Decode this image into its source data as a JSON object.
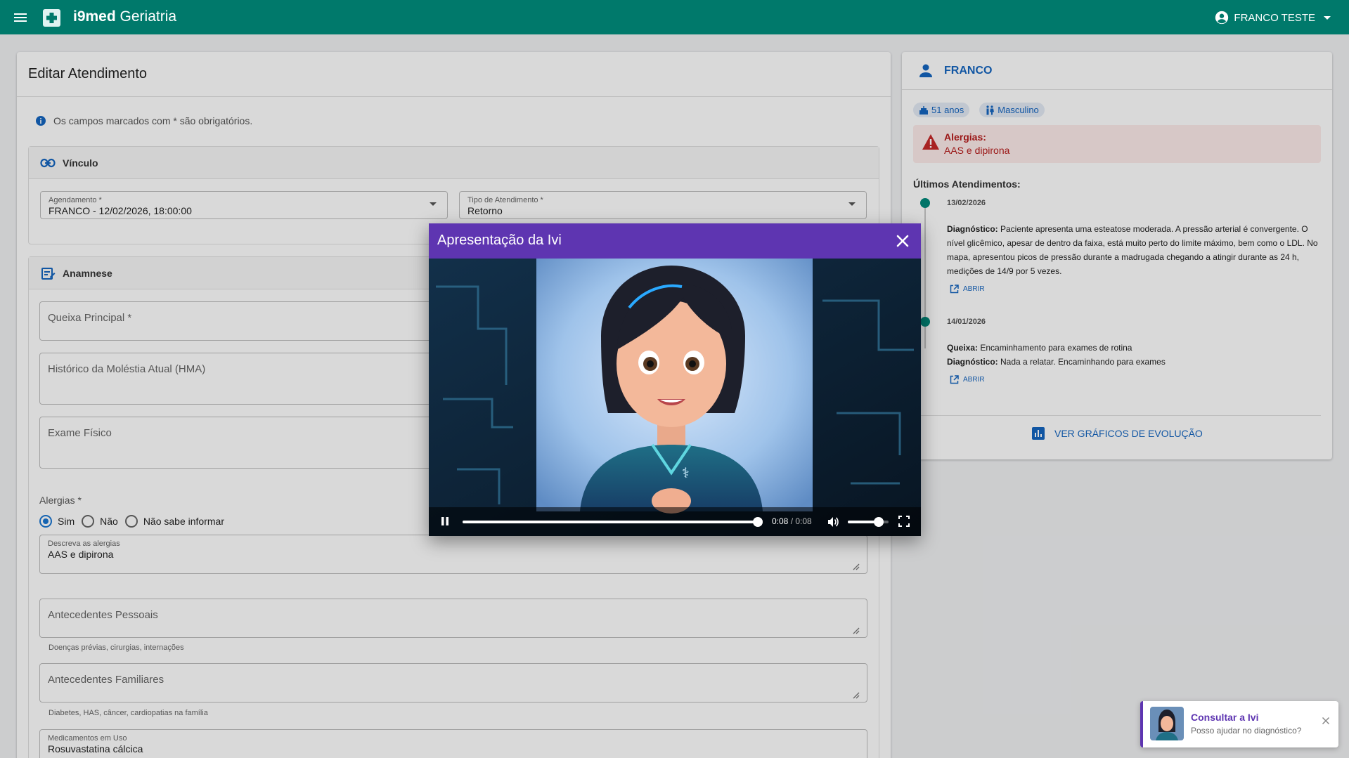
{
  "appbar": {
    "title_bold": "i9med",
    "title_rest": " Geriatria",
    "user_name": "FRANCO TESTE"
  },
  "form": {
    "title": "Editar Atendimento",
    "required_note": "Os campos marcados com * são obrigatórios.",
    "vinculo": {
      "section_title": "Vínculo",
      "agendamento_label": "Agendamento *",
      "agendamento_value": "FRANCO - 12/02/2026, 18:00:00",
      "tipo_label": "Tipo de Atendimento *",
      "tipo_value": "Retorno"
    },
    "anamnese": {
      "section_title": "Anamnese",
      "queixa_placeholder": "Queixa Principal *",
      "hma_placeholder": "Histórico da Moléstia Atual (HMA)",
      "exame_placeholder": "Exame Físico",
      "alergias_label": "Alergias *",
      "alergias_options": [
        "Sim",
        "Não",
        "Não sabe informar"
      ],
      "alergias_selected": "Sim",
      "descreva_label": "Descreva as alergias",
      "descreva_value": "AAS e dipirona",
      "antecedentes_pessoais_placeholder": "Antecedentes Pessoais",
      "antecedentes_pessoais_hint": "Doenças prévias, cirurgias, internações",
      "antecedentes_familiares_placeholder": "Antecedentes Familiares",
      "antecedentes_familiares_hint": "Diabetes, HAS, câncer, cardiopatias na família",
      "medicamentos_label": "Medicamentos em Uso",
      "medicamentos_value": "Rosuvastatina cálcica"
    }
  },
  "patient": {
    "name": "FRANCO",
    "age": "51 anos",
    "sex": "Masculino",
    "allergy_title": "Alergias:",
    "allergy_text": "AAS e dipirona",
    "history_title": "Últimos Atendimentos:",
    "history": [
      {
        "date": "13/02/2026",
        "diag_label": "Diagnóstico:",
        "diag_text": " Paciente apresenta uma esteatose moderada. A pressão arterial é convergente. O nível glicêmico, apesar de dentro da faixa, está muito perto do limite máximo, bem como o LDL. No mapa, apresentou picos de pressão durante a madrugada chegando a atingir durante as 24 h, medições de 14/9 por 5 vezes.",
        "open": "ABRIR"
      },
      {
        "date": "14/01/2026",
        "queixa_label": "Queixa:",
        "queixa_text": " Encaminhamento para exames de rotina",
        "diag_label": "Diagnóstico:",
        "diag_text": " Nada a relatar. Encaminhando para exames",
        "open": "ABRIR"
      }
    ],
    "graphs_button": "VER GRÁFICOS DE EVOLUÇÃO"
  },
  "modal": {
    "title": "Apresentação da Ivi",
    "current_time": "0:08",
    "duration": "0:08",
    "progress": 1.0,
    "volume": 0.75
  },
  "toast": {
    "title": "Consultar a Ivi",
    "subtitle": "Posso ajudar no diagnóstico?"
  },
  "colors": {
    "appbar": "#00796b",
    "modal_header": "#5e35b1",
    "link": "#1565c0",
    "allergy_bg": "#fdecea",
    "allergy_text": "#b71c1c"
  }
}
